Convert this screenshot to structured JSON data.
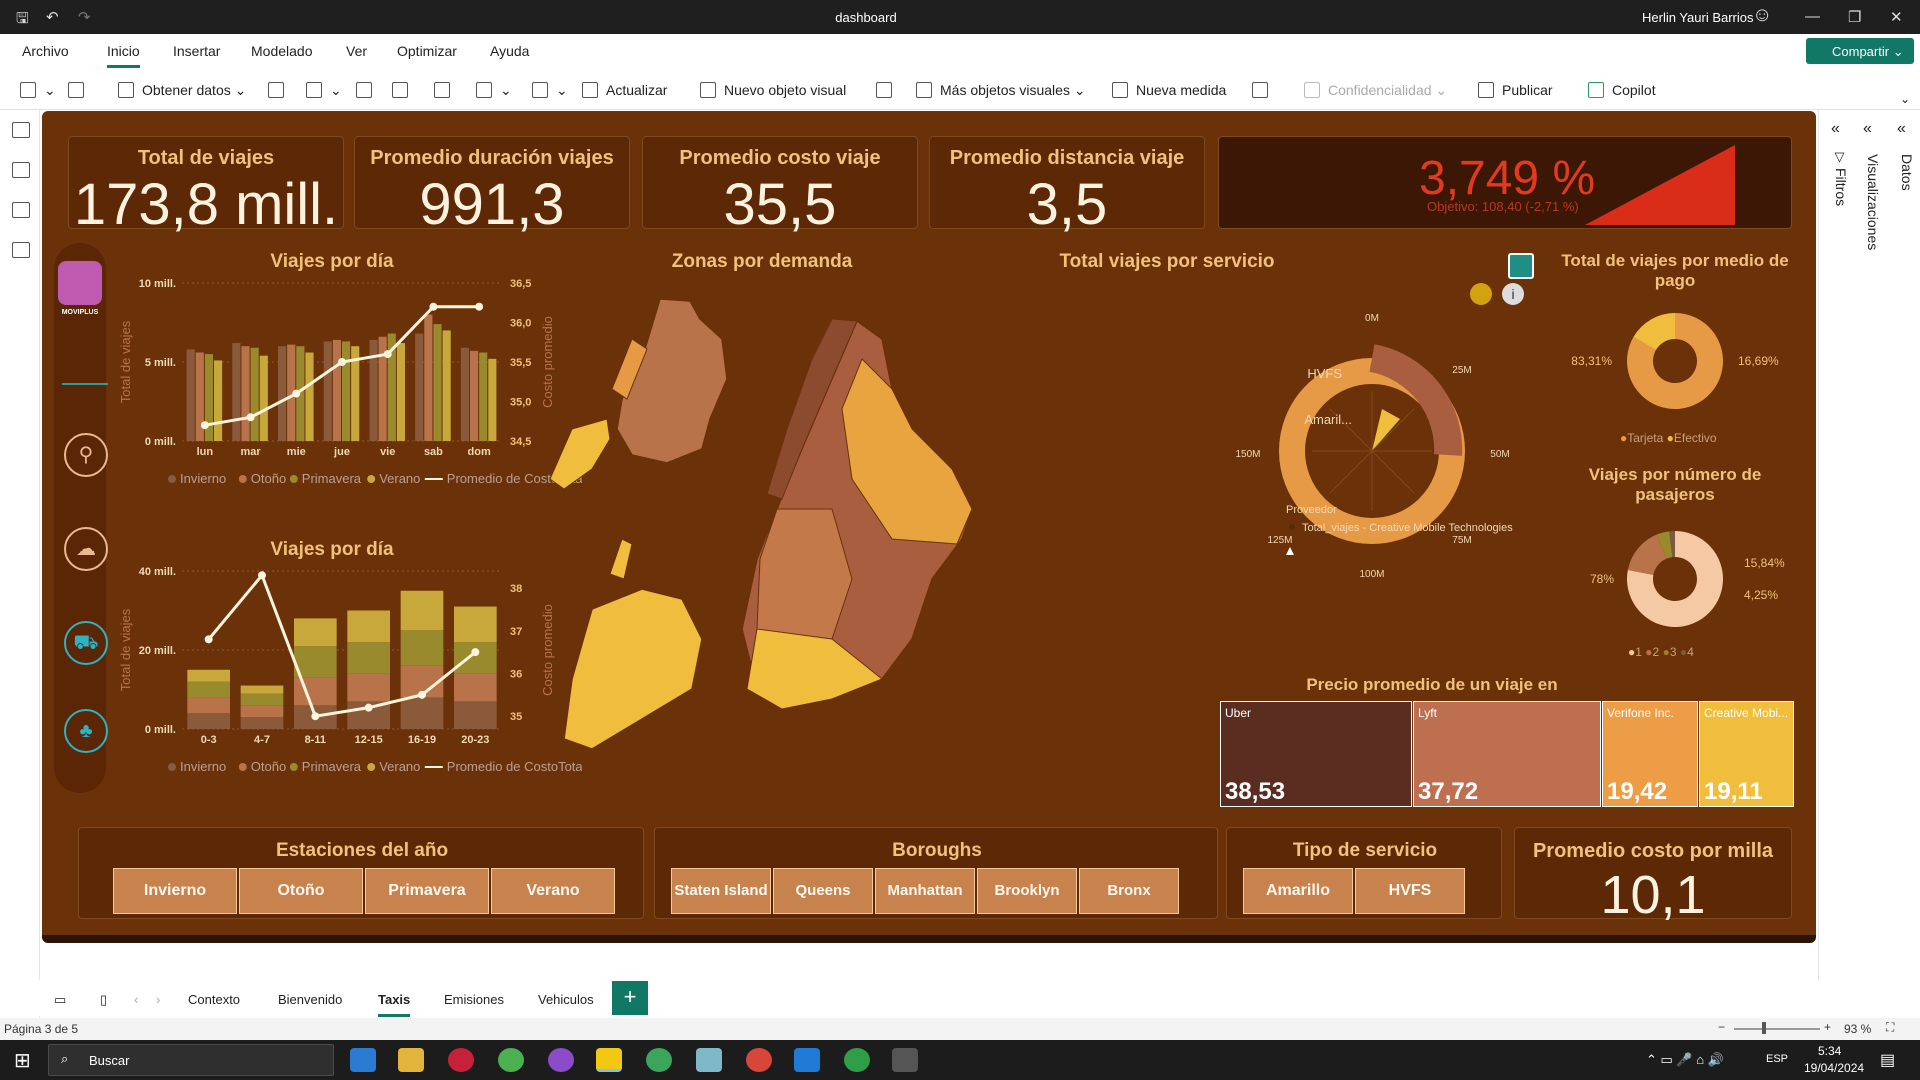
{
  "window": {
    "title": "dashboard",
    "user": "Herlin Yauri Barrios"
  },
  "menu": {
    "tabs": [
      "Archivo",
      "Inicio",
      "Insertar",
      "Modelado",
      "Ver",
      "Optimizar",
      "Ayuda"
    ],
    "share": "Compartir"
  },
  "toolbar": {
    "get_data": "Obtener datos",
    "refresh": "Actualizar",
    "new_visual": "Nuevo objeto visual",
    "more_visuals": "Más objetos visuales",
    "new_measure": "Nueva medida",
    "sensitivity": "Confidencialidad",
    "publish": "Publicar",
    "copilot": "Copilot"
  },
  "kpis": [
    {
      "label": "Total de viajes",
      "value": "173,8 mill."
    },
    {
      "label": "Promedio duración viajes",
      "value": "991,3"
    },
    {
      "label": "Promedio costo viaje",
      "value": "35,5"
    },
    {
      "label": "Promedio distancia viaje",
      "value": "3,5"
    }
  ],
  "gauge": {
    "value": "3,749 %",
    "subtitle": "Objetivo: 108,40 (-2,71 %)",
    "color": "#d92d1a"
  },
  "charts": {
    "daily": {
      "title": "Viajes por día",
      "ylabel": "Total de viajes",
      "y2label": "Costo promedio",
      "yticks": [
        "10 mill.",
        "5 mill.",
        "0 mill."
      ],
      "y2ticks": [
        "36,5",
        "36,0",
        "35,5",
        "35,0",
        "34,5"
      ],
      "legend": [
        "Invierno",
        "Otoño",
        "Primavera",
        "Verano",
        "Promedio de CostoTotal"
      ]
    },
    "hourly": {
      "title": "Viajes por día",
      "ylabel": "Total de viajes",
      "y2label": "Costo promedio",
      "yticks": [
        "40 mill.",
        "20 mill.",
        "0 mill."
      ],
      "y2ticks": [
        "38",
        "37",
        "36",
        "35"
      ],
      "legend": [
        "Invierno",
        "Otoño",
        "Primavera",
        "Verano",
        "Promedio de CostoTotal"
      ]
    },
    "map": {
      "title": "Zonas por demanda"
    },
    "service": {
      "title": "Total viajes por servicio",
      "labels": [
        "0M",
        "25M",
        "50M",
        "75M",
        "100M",
        "125M",
        "150M"
      ],
      "cat_hvfs": "HVFS",
      "cat_amarillo": "Amaril...",
      "legend_title": "Proveedor",
      "legend_item": "Total_viajes - Creative Mobile Technologies"
    },
    "payment": {
      "title": "Total de viajes por medio de pago",
      "left": "83,31%",
      "right": "16,69%",
      "legend": [
        "Tarjeta",
        "Efectivo"
      ]
    },
    "passengers": {
      "title": "Viajes por número de pasajeros",
      "left": "78%",
      "r1": "15,84%",
      "r2": "4,25%",
      "legend": [
        "1",
        "2",
        "3",
        "4"
      ]
    },
    "treemap": {
      "title": "Precio promedio de un viaje en",
      "items": [
        {
          "name": "Uber",
          "value": "38,53"
        },
        {
          "name": "Lyft",
          "value": "37,72"
        },
        {
          "name": "Verifone Inc.",
          "value": "19,42"
        },
        {
          "name": "Creative Mobi...",
          "value": "19,11"
        }
      ]
    }
  },
  "chart_data": [
    {
      "type": "bar",
      "title": "Viajes por día",
      "categories": [
        "lun",
        "mar",
        "mie",
        "jue",
        "vie",
        "sab",
        "dom"
      ],
      "series": [
        {
          "name": "Invierno",
          "values": [
            5.8,
            6.2,
            6.0,
            6.3,
            6.4,
            6.8,
            5.9
          ]
        },
        {
          "name": "Otoño",
          "values": [
            5.6,
            6.0,
            6.1,
            6.4,
            6.6,
            8.0,
            5.7
          ]
        },
        {
          "name": "Primavera",
          "values": [
            5.5,
            5.9,
            6.0,
            6.3,
            6.8,
            7.4,
            5.6
          ]
        },
        {
          "name": "Verano",
          "values": [
            5.1,
            5.4,
            5.6,
            6.0,
            6.2,
            7.0,
            5.2
          ]
        },
        {
          "name": "Promedio de CostoTotal",
          "values": [
            34.7,
            34.8,
            35.1,
            35.5,
            35.6,
            36.2,
            36.2
          ]
        }
      ],
      "ylim": [
        0,
        10
      ],
      "y2lim": [
        34.5,
        36.5
      ]
    },
    {
      "type": "bar",
      "title": "Viajes por día",
      "categories": [
        "0-3",
        "4-7",
        "8-11",
        "12-15",
        "16-19",
        "20-23"
      ],
      "series": [
        {
          "name": "Invierno",
          "values": [
            4,
            3,
            6,
            7,
            8,
            7
          ]
        },
        {
          "name": "Otoño",
          "values": [
            4,
            3,
            7,
            7,
            8,
            7
          ]
        },
        {
          "name": "Primavera",
          "values": [
            4,
            3,
            8,
            8,
            9,
            8
          ]
        },
        {
          "name": "Verano",
          "values": [
            3,
            2,
            7,
            8,
            10,
            9
          ]
        },
        {
          "name": "Promedio de CostoTotal",
          "values": [
            36.8,
            38.3,
            35.0,
            35.2,
            35.5,
            36.5
          ]
        }
      ],
      "ylim": [
        0,
        40
      ],
      "y2lim": [
        34.7,
        38.4
      ]
    },
    {
      "type": "pie",
      "title": "Total de viajes por medio de pago",
      "categories": [
        "Tarjeta",
        "Efectivo"
      ],
      "values": [
        83.31,
        16.69
      ]
    },
    {
      "type": "pie",
      "title": "Viajes por número de pasajeros",
      "categories": [
        "1",
        "2",
        "3",
        "4"
      ],
      "values": [
        78,
        15.84,
        4.25,
        1.91
      ]
    }
  ],
  "slicers": {
    "seasons": {
      "title": "Estaciones del año",
      "items": [
        "Invierno",
        "Otoño",
        "Primavera",
        "Verano"
      ]
    },
    "boroughs": {
      "title": "Boroughs",
      "items": [
        "Staten Island",
        "Queens",
        "Manhattan",
        "Brooklyn",
        "Bronx"
      ]
    },
    "service": {
      "title": "Tipo de servicio",
      "items": [
        "Amarillo",
        "HVFS"
      ]
    },
    "cost": {
      "title": "Promedio costo por milla",
      "value": "10,1"
    }
  },
  "logo": "MOVIPLUS",
  "right_panes": [
    "Filtros",
    "Visualizaciones",
    "Datos"
  ],
  "pages": [
    "Contexto",
    "Bienvenido",
    "Taxis",
    "Emisiones",
    "Vehiculos"
  ],
  "status": {
    "page": "Página 3 de 5",
    "zoom": "93 %"
  },
  "taskbar": {
    "search": "Buscar",
    "lang": "ESP",
    "time": "5:34",
    "date": "19/04/2024"
  }
}
